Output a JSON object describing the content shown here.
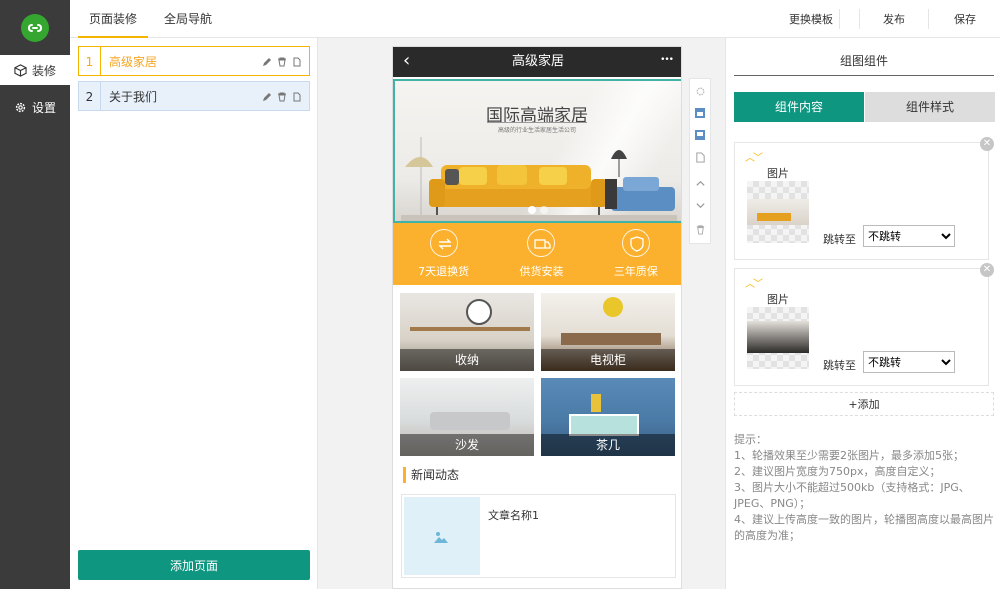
{
  "sidebar": {
    "items": [
      {
        "label": "装修",
        "icon": "cube-icon"
      },
      {
        "label": "设置",
        "icon": "gear-icon"
      }
    ]
  },
  "topbar": {
    "tabs": [
      "页面装修",
      "全局导航"
    ],
    "buttons": [
      "更换模板",
      "发布",
      "保存"
    ]
  },
  "pages": {
    "rows": [
      {
        "num": "1",
        "name": "高级家居"
      },
      {
        "num": "2",
        "name": "关于我们"
      }
    ],
    "add_label": "添加页面"
  },
  "phone": {
    "back": "‹",
    "title": "高级家居",
    "more": "•••",
    "banner": {
      "heading": "国际高端家居",
      "subheading": "高级的行业生活家居生活公司"
    },
    "features": [
      "7天退换货",
      "供货安装",
      "三年质保"
    ],
    "tiles": [
      "收纳",
      "电视柜",
      "沙发",
      "茶几"
    ],
    "news_title": "新闻动态",
    "article_title": "文章名称1"
  },
  "rightpanel": {
    "title": "组图组件",
    "tabs": [
      "组件内容",
      "组件样式"
    ],
    "cards": [
      {
        "img_label": "图片",
        "jump_label": "跳转至",
        "select_value": "不跳转"
      },
      {
        "img_label": "图片",
        "jump_label": "跳转至",
        "select_value": "不跳转"
      }
    ],
    "add_label": "+添加",
    "tips": [
      "提示：",
      "1、轮播效果至少需要2张图片，最多添加5张；",
      "2、建议图片宽度为750px，高度自定义；",
      "3、图片大小不能超过500kb（支持格式：JPG、JPEG、PNG）；",
      "4、建议上传高度一致的图片，轮播图高度以最高图片的高度为准；"
    ]
  },
  "colors": {
    "accent": "#0e9680",
    "highlight": "#f5b400",
    "band": "#fbb12d",
    "sidebar": "#3b3b3b"
  }
}
